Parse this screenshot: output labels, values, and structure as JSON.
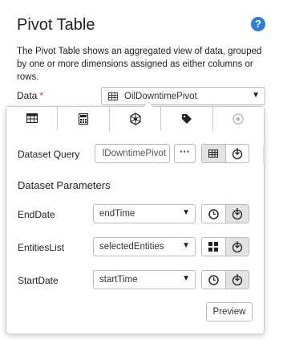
{
  "header": {
    "title": "Pivot Table",
    "help_icon": "?"
  },
  "description": "The Pivot Table shows an aggregated view of data, grouped by one or more dimensions assigned as either columns or rows.",
  "data_field": {
    "label": "Data",
    "required_mark": "*",
    "value": "OilDowntimePivot",
    "icon": "table-icon"
  },
  "popover": {
    "tabs": [
      {
        "icon": "table-icon",
        "active": true
      },
      {
        "icon": "calculator-icon",
        "active": false
      },
      {
        "icon": "network-icon",
        "active": false
      },
      {
        "icon": "tag-icon",
        "active": false
      },
      {
        "icon": "circle-dot-icon",
        "active": false
      }
    ],
    "dataset_query": {
      "label": "Dataset Query",
      "value": "lDowntimePivot",
      "more_label": "···"
    },
    "params_title": "Dataset Parameters",
    "params": [
      {
        "label": "EndDate",
        "value": "endTime",
        "mode": "clock"
      },
      {
        "label": "EntitiesList",
        "value": "selectedEntities",
        "mode": "grid"
      },
      {
        "label": "StartDate",
        "value": "startTime",
        "mode": "clock"
      }
    ],
    "preview_label": "Preview"
  }
}
